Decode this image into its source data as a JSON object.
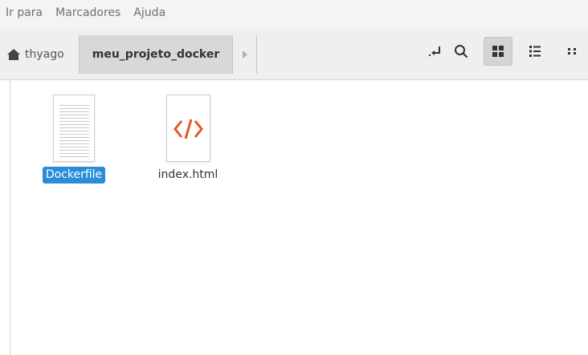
{
  "menu": {
    "items": [
      "Ir para",
      "Marcadores",
      "Ajuda"
    ]
  },
  "pathbar": {
    "home_label": "thyago",
    "current_label": "meu_projeto_docker"
  },
  "toolbar": {
    "buttons": [
      {
        "icon": "enter-location-icon",
        "active": false
      },
      {
        "icon": "search-icon",
        "active": false
      },
      {
        "icon": "grid-view-icon",
        "active": true
      },
      {
        "icon": "list-view-icon",
        "active": false
      },
      {
        "icon": "compact-view-icon",
        "active": false
      }
    ]
  },
  "files": [
    {
      "name": "Dockerfile",
      "icon": "text-file-icon",
      "selected": true
    },
    {
      "name": "index.html",
      "icon": "html-file-icon",
      "selected": false
    }
  ],
  "colors": {
    "selection": "#2a8dd8",
    "html_icon": "#e8561f"
  }
}
